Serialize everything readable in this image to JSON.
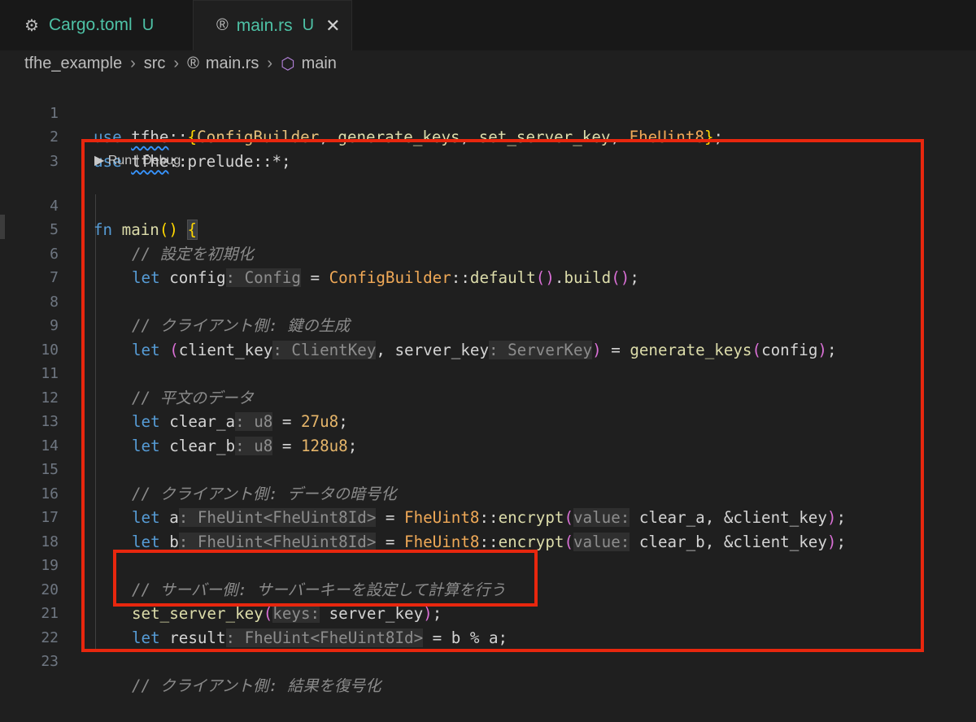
{
  "tabs": [
    {
      "label": "Cargo.toml",
      "badge": "U",
      "icon": "gear-icon"
    },
    {
      "label": "main.rs",
      "badge": "U",
      "icon": "rust-icon",
      "close": "✕"
    }
  ],
  "breadcrumb": {
    "items": [
      "tfhe_example",
      "src",
      "main.rs",
      "main"
    ],
    "separator": "›"
  },
  "codelens": {
    "run": "Run",
    "sep": " | ",
    "debug": "Debug"
  },
  "line_numbers": [
    "1",
    "2",
    "3",
    "4",
    "5",
    "6",
    "7",
    "8",
    "9",
    "10",
    "11",
    "12",
    "13",
    "14",
    "15",
    "16",
    "17",
    "18",
    "19",
    "20",
    "21",
    "22",
    "23"
  ],
  "code": {
    "l1": {
      "t0": "use ",
      "t1": "tfhe",
      "t2": "::",
      "t3": "{",
      "t4": "ConfigBuilder",
      "t5": ", ",
      "t6": "generate_keys",
      "t7": ", ",
      "t8": "set_server_key",
      "t9": ", ",
      "t10": "FheUint8",
      "t11": "}",
      "t12": ";"
    },
    "l2": {
      "t0": "use ",
      "t1": "tfhe",
      "t2": "::prelude::*;"
    },
    "l4": {
      "t0": "fn ",
      "t1": "main",
      "t2": "()",
      "t3": " ",
      "t4": "{"
    },
    "l5": {
      "t0": "// 設定を初期化"
    },
    "l6": {
      "t0": "let ",
      "t1": "config",
      "t2": ": Config",
      "t3": " = ",
      "t4": "ConfigBuilder",
      "t5": "::",
      "t6": "default",
      "t7": "()",
      "t8": ".",
      "t9": "build",
      "t10": "()",
      "t11": ";"
    },
    "l8": {
      "t0": "// クライアント側: 鍵の生成"
    },
    "l9": {
      "t0": "let ",
      "t1": "(",
      "t2": "client_key",
      "t3": ": ClientKey",
      "t4": ", server_key",
      "t5": ": ServerKey",
      "t6": ")",
      "t7": " = ",
      "t8": "generate_keys",
      "t9": "(",
      "t10": "config",
      "t11": ")",
      "t12": ";"
    },
    "l11": {
      "t0": "// 平文のデータ"
    },
    "l12": {
      "t0": "let ",
      "t1": "clear_a",
      "t2": ": u8",
      "t3": " = ",
      "t4": "27u8",
      "t5": ";"
    },
    "l13": {
      "t0": "let ",
      "t1": "clear_b",
      "t2": ": u8",
      "t3": " = ",
      "t4": "128u8",
      "t5": ";"
    },
    "l15": {
      "t0": "// クライアント側: データの暗号化"
    },
    "l16": {
      "t0": "let ",
      "t1": "a",
      "t2": ": FheUint<FheUint8Id>",
      "t3": " = ",
      "t4": "FheUint8",
      "t5": "::",
      "t6": "encrypt",
      "t7": "(",
      "t8": "value:",
      "t9": " clear_a, &client_key",
      "t10": ")",
      "t11": ";"
    },
    "l17": {
      "t0": "let ",
      "t1": "b",
      "t2": ": FheUint<FheUint8Id>",
      "t3": " = ",
      "t4": "FheUint8",
      "t5": "::",
      "t6": "encrypt",
      "t7": "(",
      "t8": "value:",
      "t9": " clear_b, &client_key",
      "t10": ")",
      "t11": ";"
    },
    "l19": {
      "t0": "// サーバー側: サーバーキーを設定して計算を行う"
    },
    "l20": {
      "t0": "set_server_key",
      "t1": "(",
      "t2": "keys:",
      "t3": " server_key",
      "t4": ")",
      "t5": ";"
    },
    "l21": {
      "t0": "let ",
      "t1": "result",
      "t2": ": FheUint<FheUint8Id>",
      "t3": " = b % a;"
    },
    "l23": {
      "t0": "// クライアント側: 結果を復号化"
    }
  },
  "colors": {
    "tab_text": "#4ec2a6",
    "keyword": "#569cd6",
    "function": "#dcdcaa",
    "highlight_box": "#e8270e"
  }
}
